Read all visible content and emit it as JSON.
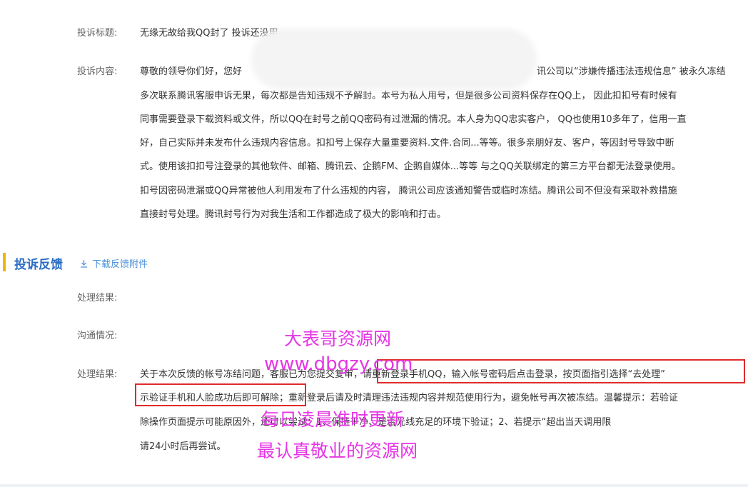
{
  "complaint": {
    "title_label": "投诉标题:",
    "title_value": "无缘无故给我QQ封了 投诉还没用",
    "content_label": "投诉内容:",
    "content_lines": [
      "尊敬的领导你们好，您好",
      "讯公司以“涉嫌传播违法违规信息” 被永久冻结",
      "多次联系腾讯客服申诉无果，每次都是告知违规不予解封。本号为私人用号，但是很多公司资料保存在QQ上，  因此扣扣号有时候有",
      "同事需要登录下载资料或文件，所以QQ在封号之前QQ密码有过泄漏的情况。本人身为QQ忠实客户，  QQ也使用10多年了，信用一直",
      "好，自己实际并未发布什么违规内容信息。扣扣号上保存大量重要资料.文件.合同...等等。很多亲朋好友、客户，等因封号导致中断",
      "式。使用该扣扣号注登录的其他软件、邮箱、腾讯云、企鹅FM、企鹅自媒体...等等 与之QQ关联绑定的第三方平台都无法登录使用。",
      "扣号因密码泄漏或QQ异常被他人利用发布了什么违规的内容，  腾讯公司应该通知警告或临时冻结。腾讯公司不但没有采取补救措施",
      "直接封号处理。腾讯封号行为对我生活和工作都造成了极大的影响和打击。"
    ]
  },
  "feedback": {
    "section_title": "投诉反馈",
    "download_label": "下载反馈附件",
    "result_label_1": "处理结果:",
    "communication_label": "沟通情况:",
    "result_label_2": "处理结果:",
    "result_lines": [
      "关于本次反馈的帐号冻结问题，客服已为您提交复审，请重新登录手机QQ，输入帐号密码后点击登录，按页面指引选择“去处理”",
      "示验证手机和人脸成功后即可解除；重新登录后请及时清理违法违规内容并规范使用行为，避免帐号再次被冻结。温馨提示：若验证",
      "除操作页面提示可能原因外，还可以尝试：1、保持干净、是否光线充足的环境下验证；2、若提示“超出当天调用限",
      "请24小时后再尝试。"
    ]
  },
  "watermark": {
    "line1": "大表哥资源网",
    "line2": "www.dbgzy.com",
    "line3": "每日凌晨准时更新",
    "line4": "最认真敬业的资源网",
    "color": "#e636e6"
  },
  "colors": {
    "accent": "#2b6cc4",
    "section_marker": "#f5b400",
    "highlight_box": "#e02b2b"
  }
}
